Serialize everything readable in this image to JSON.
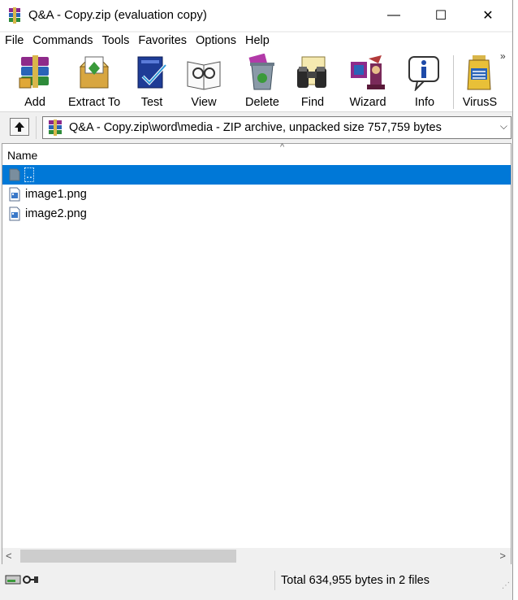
{
  "window": {
    "title": "Q&A - Copy.zip (evaluation copy)",
    "controls": {
      "minimize": "—",
      "maximize": "☐",
      "close": "✕"
    }
  },
  "menu": [
    "File",
    "Commands",
    "Tools",
    "Favorites",
    "Options",
    "Help"
  ],
  "toolbar": {
    "buttons": [
      {
        "label": "Add",
        "icon": "add-archive-icon"
      },
      {
        "label": "Extract To",
        "icon": "extract-to-icon"
      },
      {
        "label": "Test",
        "icon": "test-icon"
      },
      {
        "label": "View",
        "icon": "view-icon"
      },
      {
        "label": "Delete",
        "icon": "delete-icon"
      },
      {
        "label": "Find",
        "icon": "find-binoculars-icon"
      },
      {
        "label": "Wizard",
        "icon": "wizard-icon"
      },
      {
        "label": "Info",
        "icon": "info-icon"
      },
      {
        "label": "VirusS",
        "icon": "virus-scan-icon"
      }
    ],
    "more": "»"
  },
  "address": {
    "path": "Q&A - Copy.zip\\word\\media - ZIP archive, unpacked size 757,759 bytes",
    "dropdown": "⌵"
  },
  "filelist": {
    "column_name": "Name",
    "sort_caret": "^",
    "rows": [
      {
        "name": "..",
        "selected": true,
        "icon": "parent-folder-icon"
      },
      {
        "name": "image1.png",
        "selected": false,
        "icon": "png-file-icon"
      },
      {
        "name": "image2.png",
        "selected": false,
        "icon": "png-file-icon"
      }
    ],
    "scroll_left": "<",
    "scroll_right": ">"
  },
  "status": {
    "text": "Total 634,955 bytes in 2 files"
  },
  "colors": {
    "selection": "#0078d7",
    "window_bg": "#f0f0f0"
  }
}
